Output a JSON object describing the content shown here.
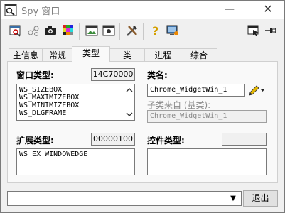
{
  "window": {
    "title": "Spy 窗口",
    "minimize_glyph": "—",
    "close_glyph": "✕"
  },
  "toolbar": {
    "left_icons": [
      "spy-window-icon",
      "graph-nodes-icon",
      "camera-icon",
      "color-grid-icon",
      "window-image-icon",
      "window-frame-icon",
      "tools-icon",
      "help-question-icon",
      "monitor-icon"
    ],
    "right_icons": [
      "find-window-icon",
      "pin-icon"
    ]
  },
  "tabs": [
    {
      "label": "主信息",
      "active": false
    },
    {
      "label": "常规",
      "active": false
    },
    {
      "label": "类型",
      "active": true
    },
    {
      "label": "类",
      "active": false
    },
    {
      "label": "进程",
      "active": false
    },
    {
      "label": "综合",
      "active": false
    }
  ],
  "window_style": {
    "label": "窗口类型:",
    "value": "14C70000",
    "items": [
      "WS_SIZEBOX",
      "WS_MAXIMIZEBOX",
      "WS_MINIMIZEBOX",
      "WS_DLGFRAME"
    ]
  },
  "class_name": {
    "label": "类名:",
    "value": "Chrome_WidgetWin_1",
    "subclass_label": "子类来自 (基类):",
    "subclass_value": "Chrome_WidgetWin_1"
  },
  "ex_style": {
    "label": "扩展类型:",
    "value": "00000100",
    "items": [
      "WS_EX_WINDOWEDGE"
    ]
  },
  "control_type": {
    "label": "控件类型:",
    "value": ""
  },
  "bottom": {
    "input_value": "",
    "dropdown_glyph": "▼",
    "exit_label": "退出"
  },
  "colors": {
    "panel": "#f9f9f9",
    "window_bg": "#f0f0f0",
    "border": "#7a7a7a",
    "disabled_text": "#8a8a8a"
  }
}
